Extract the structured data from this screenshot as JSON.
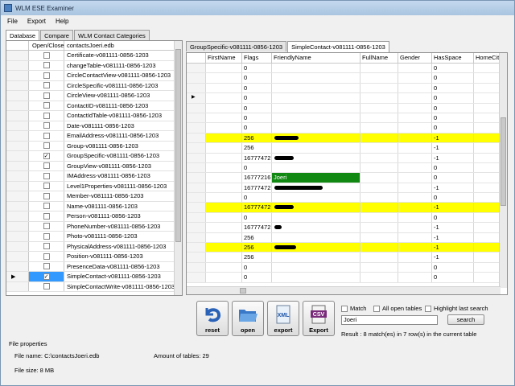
{
  "window": {
    "title": "WLM ESE Examiner"
  },
  "menu": [
    "File",
    "Export",
    "Help"
  ],
  "left_tabs": [
    {
      "label": "Database",
      "active": true
    },
    {
      "label": "Compare",
      "active": false
    },
    {
      "label": "WLM Contact Categories",
      "active": false
    }
  ],
  "table_list": {
    "col_open": "Open/Close",
    "col_name": "contactsJoeri.edb",
    "rows": [
      {
        "name": "Certificate-v081111-0856-1203",
        "checked": false
      },
      {
        "name": "changeTable-v081111-0856-1203",
        "checked": false
      },
      {
        "name": "CircleContactView-v081111-0856-1203",
        "checked": false
      },
      {
        "name": "CircleSpecific-v081111-0856-1203",
        "checked": false
      },
      {
        "name": "CircleView-v081111-0856-1203",
        "checked": false
      },
      {
        "name": "ContactID-v081111-0856-1203",
        "checked": false
      },
      {
        "name": "ContactIdTable-v081111-0856-1203",
        "checked": false
      },
      {
        "name": "Date-v081111-0856-1203",
        "checked": false
      },
      {
        "name": "EmailAddress-v081111-0856-1203",
        "checked": false
      },
      {
        "name": "Group-v081111-0856-1203",
        "checked": false
      },
      {
        "name": "GroupSpecific-v081111-0856-1203",
        "checked": true
      },
      {
        "name": "GroupView-v081111-0856-1203",
        "checked": false
      },
      {
        "name": "IMAddress-v081111-0856-1203",
        "checked": false
      },
      {
        "name": "Level1Properties-v081111-0856-1203",
        "checked": false
      },
      {
        "name": "Member-v081111-0856-1203",
        "checked": false
      },
      {
        "name": "Name-v081111-0856-1203",
        "checked": false
      },
      {
        "name": "Person-v081111-0856-1203",
        "checked": false
      },
      {
        "name": "PhoneNumber-v081111-0856-1203",
        "checked": false
      },
      {
        "name": "Photo-v081111-0856-1203",
        "checked": false
      },
      {
        "name": "PhysicalAddress-v081111-0856-1203",
        "checked": false
      },
      {
        "name": "Position-v081111-0856-1203",
        "checked": false
      },
      {
        "name": "PresenceData-v081111-0856-1203",
        "checked": false
      },
      {
        "name": "SimpleContact-v081111-0856-1203",
        "checked": true,
        "selected": true,
        "pointer": "▶"
      },
      {
        "name": "SimpleContactWrite-v081111-0856-1203",
        "checked": false
      }
    ]
  },
  "right_tabs": [
    {
      "label": "GroupSpecific-v081111-0856-1203",
      "active": false
    },
    {
      "label": "SimpleContact-v081111-0856-1203",
      "active": true
    }
  ],
  "grid": {
    "columns": [
      "",
      "FirstName",
      "Flags",
      "FriendlyName",
      "FullName",
      "Gender",
      "HasSpace",
      "HomeCity"
    ],
    "rows": [
      {
        "flags": "0",
        "has_space": "0"
      },
      {
        "flags": "0",
        "has_space": "0"
      },
      {
        "flags": "0",
        "has_space": "0"
      },
      {
        "flags": "0",
        "has_space": "0",
        "pointer": "▶"
      },
      {
        "flags": "0",
        "has_space": "0"
      },
      {
        "flags": "0",
        "has_space": "0"
      },
      {
        "flags": "0",
        "has_space": "0"
      },
      {
        "flags": "256",
        "has_space": "-1",
        "highlight": "yellow",
        "redacted": 0.5
      },
      {
        "flags": "256",
        "has_space": "-1"
      },
      {
        "flags": "16777472",
        "has_space": "-1",
        "redacted": 0.4
      },
      {
        "flags": "0",
        "has_space": "0"
      },
      {
        "flags": "16777216",
        "friendly": "Joeri",
        "has_space": "0",
        "highlight": "green"
      },
      {
        "flags": "16777472",
        "has_space": "-1",
        "redacted": 1.0
      },
      {
        "flags": "0",
        "has_space": "0"
      },
      {
        "flags": "16777472",
        "has_space": "-1",
        "highlight": "yellow",
        "redacted": 0.4
      },
      {
        "flags": "0",
        "has_space": "0"
      },
      {
        "flags": "16777472",
        "has_space": "-1",
        "redacted": 0.15
      },
      {
        "flags": "256",
        "has_space": "-1"
      },
      {
        "flags": "256",
        "has_space": "-1",
        "highlight": "yellow",
        "redacted": 0.45
      },
      {
        "flags": "256",
        "has_space": "-1"
      },
      {
        "flags": "0",
        "has_space": "0"
      },
      {
        "flags": "0",
        "has_space": "0"
      }
    ]
  },
  "toolbar": {
    "reset": "reset",
    "open": "open",
    "export_xml": "export",
    "export_csv": "Export",
    "xml_icon_text": "XML",
    "csv_icon_text": "CSV"
  },
  "search": {
    "match_label": "Match",
    "all_tables_label": "All open tables",
    "highlight_label": "Highlight last search",
    "query": "Joeri",
    "button": "search",
    "result": "Result : 8 match(es) in 7 row(s) in the current table"
  },
  "file_properties": {
    "heading": "File properties",
    "file_name": "File name: C:\\contactsJoeri.edb",
    "tables": "Amount of tables: 29",
    "size": "File size: 8 MB"
  },
  "colors": {
    "highlight_yellow": "#ffff00",
    "highlight_green": "#118811",
    "selection": "#3399ff"
  }
}
